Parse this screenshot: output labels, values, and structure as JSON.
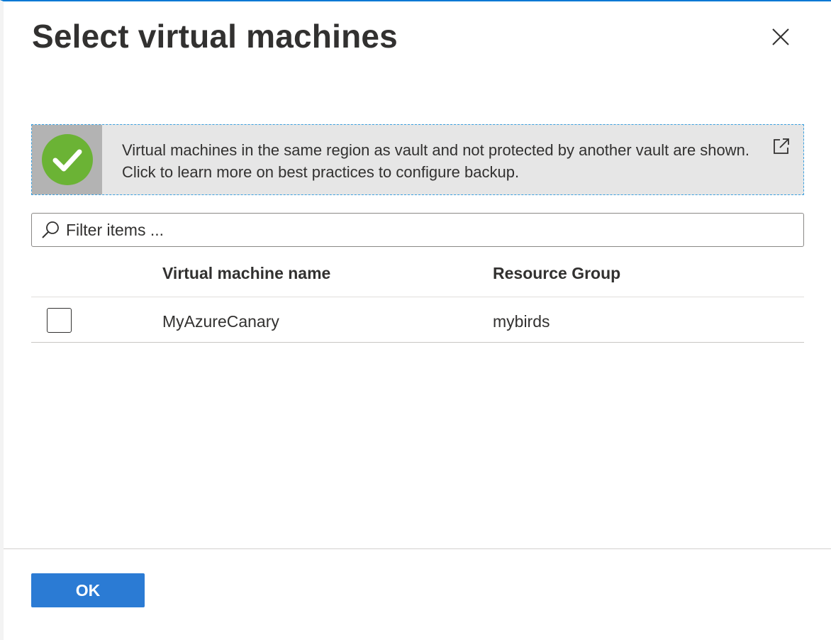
{
  "header": {
    "title": "Select virtual machines",
    "close_icon": "close-icon"
  },
  "info_banner": {
    "icon": "success-check-icon",
    "icon_color": "#6bb335",
    "text": "Virtual machines in the same region as vault and not protected by another vault are shown. Click to learn more on best practices to configure backup.",
    "link_icon": "external-link-icon"
  },
  "filter": {
    "placeholder": "Filter items ...",
    "value": ""
  },
  "table": {
    "columns": [
      "Virtual machine name",
      "Resource Group"
    ],
    "rows": [
      {
        "checked": false,
        "name": "MyAzureCanary",
        "resource_group": "mybirds"
      }
    ]
  },
  "footer": {
    "ok_label": "OK"
  },
  "colors": {
    "accent": "#0078d4",
    "primary_button": "#2b7bd4",
    "success": "#6bb335"
  }
}
